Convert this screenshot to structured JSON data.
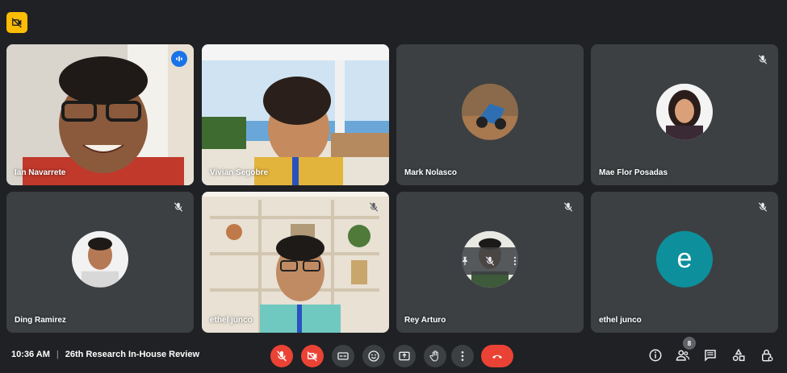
{
  "participants": [
    {
      "name": "Ian Navarrete"
    },
    {
      "name": "Vivian Segobre"
    },
    {
      "name": "Mark Nolasco"
    },
    {
      "name": "Mae Flor Posadas"
    },
    {
      "name": "Ding Ramirez"
    },
    {
      "name": "ethel junco"
    },
    {
      "name": "Rey Arturo"
    },
    {
      "name": "ethel junco",
      "avatar_letter": "e"
    }
  ],
  "meeting": {
    "time": "10:36 AM",
    "separator": "|",
    "title": "26th Research In-House Review"
  },
  "people_count": "8",
  "icons": {
    "top_badge": "camera-off-icon",
    "speaking": "audio-level-icon",
    "mute": "mic-off-icon",
    "controls": [
      "mic-off-icon",
      "camera-off-icon",
      "captions-icon",
      "emoji-icon",
      "present-icon",
      "raise-hand-icon",
      "more-options-icon",
      "end-call-icon"
    ],
    "right": [
      "info-icon",
      "people-icon",
      "chat-icon",
      "activities-icon",
      "host-controls-icon"
    ]
  },
  "colors": {
    "background": "#202124",
    "tile": "#3c4043",
    "active_border": "#8ab4f8",
    "danger": "#ea4335",
    "badge": "#fbbc04",
    "letter_avatar": "#0d8f9c"
  }
}
